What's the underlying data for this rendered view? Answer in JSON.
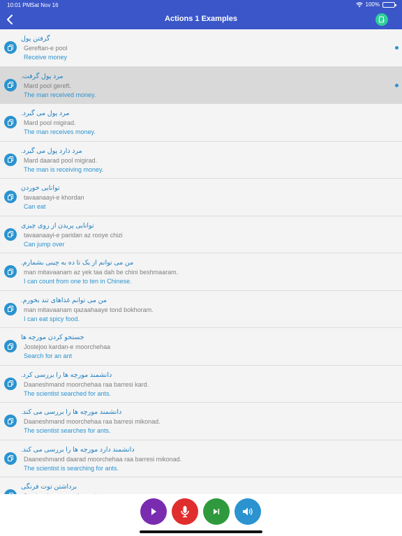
{
  "status": {
    "time": "10:01 PM",
    "date": "Sat Nov 16",
    "battery": "100%"
  },
  "header": {
    "title": "Actions 1 Examples"
  },
  "items": [
    {
      "persian": "گرفتن پول",
      "translit": "Gereftan-e pool",
      "english": "Receive money",
      "selected": false,
      "dot": true
    },
    {
      "persian": "مرد پول گرفت.",
      "translit": "Mard pool gereft.",
      "english": "The man received money.",
      "selected": true,
      "dot": true
    },
    {
      "persian": "مرد پول می گیرد.",
      "translit": "Mard pool migirad.",
      "english": "The man receives money.",
      "selected": false,
      "dot": false
    },
    {
      "persian": "مرد دارد پول می گیرد.",
      "translit": "Mard daarad pool migirad.",
      "english": "The man is receiving money.",
      "selected": false,
      "dot": false
    },
    {
      "persian": "توانایی خوردن",
      "translit": "tavaanaayi-e khordan",
      "english": "Can eat",
      "selected": false,
      "dot": false
    },
    {
      "persian": "توانایی پریدن از روی چیزی",
      "translit": "tavaanaayi-e paridan az rooye chizi",
      "english": "Can jump over",
      "selected": false,
      "dot": false
    },
    {
      "persian": "من می توانم از یک تا ده به چینی بشمارم.",
      "translit": "man mitavaanam az yek taa dah be chini beshmaaram.",
      "english": "I can count from one to ten in Chinese.",
      "selected": false,
      "dot": false
    },
    {
      "persian": "من می توانم غذاهای تند بخورم.",
      "translit": "man mitavaanam qazaahaaye tond bokhoram.",
      "english": "I can eat spicy food.",
      "selected": false,
      "dot": false
    },
    {
      "persian": "جستجو کردن مورچه ها",
      "translit": "Jostejoo kardan-e moorchehaa",
      "english": "Search for an ant",
      "selected": false,
      "dot": false
    },
    {
      "persian": "دانشمند مورچه ها را بررسی کرد.",
      "translit": "Daaneshmand moorchehaa raa barresi kard.",
      "english": "The scientist searched for ants.",
      "selected": false,
      "dot": false
    },
    {
      "persian": "دانشمند مورچه ها را بررسی می کند.",
      "translit": "Daaneshmand moorchehaa raa barresi mikonad.",
      "english": "The scientist searches for ants.",
      "selected": false,
      "dot": false
    },
    {
      "persian": "دانشمند دارد مورچه ها را بررسی می کند.",
      "translit": "Daaneshmand daarad moorchehaa raa barresi mikonad.",
      "english": "The scientist is searching for ants.",
      "selected": false,
      "dot": false
    },
    {
      "persian": "برداشتن توت فرنگی",
      "translit": "Bardaashtan-e tootfarangi",
      "english": "",
      "selected": false,
      "dot": false
    }
  ],
  "controls": {
    "play_icon": "play-icon",
    "mic_icon": "microphone-icon",
    "next_icon": "skip-next-icon",
    "speaker_icon": "speaker-icon",
    "colors": {
      "header": "#3a56c8",
      "play": "#7a2cb0",
      "mic": "#e02d2d",
      "next": "#2f9a3d",
      "speaker": "#2b93cf",
      "accent_text": "#1f7fc0"
    }
  }
}
